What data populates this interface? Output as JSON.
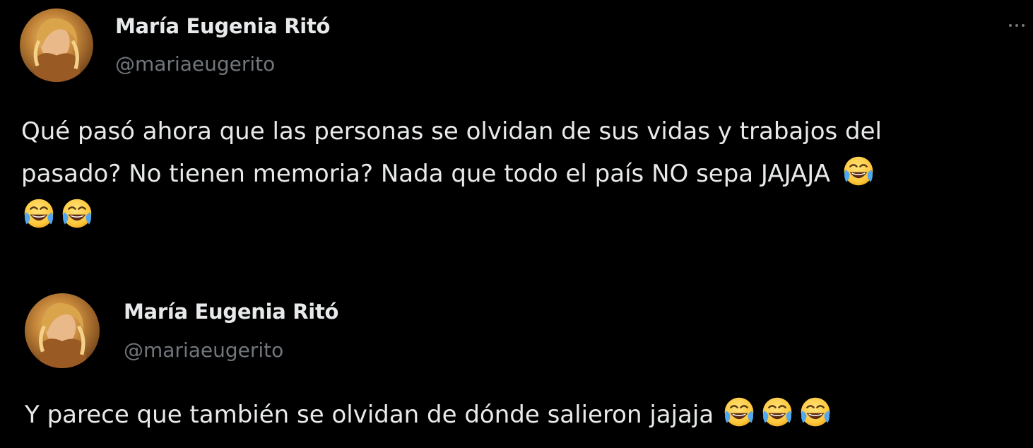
{
  "tweets": [
    {
      "author": {
        "display_name": "María Eugenia Ritó",
        "handle": "@mariaeugerito"
      },
      "text_line_1": "Qué pasó ahora que las personas se olvidan de sus vidas y trabajos del",
      "text_line_2": "pasado? No tienen memoria? Nada que todo el país NO sepa JAJAJA",
      "emoji": "face-with-tears-of-joy-icon",
      "emoji_count": 3
    },
    {
      "author": {
        "display_name": "María Eugenia Ritó",
        "handle": "@mariaeugerito"
      },
      "text_line_1": "Y parece que también se olvidan de dónde salieron jajaja",
      "emoji": "face-with-tears-of-joy-icon",
      "emoji_count": 3
    }
  ],
  "colors": {
    "background": "#000000",
    "text_primary": "#e7e9ea",
    "text_secondary": "#71767b"
  }
}
